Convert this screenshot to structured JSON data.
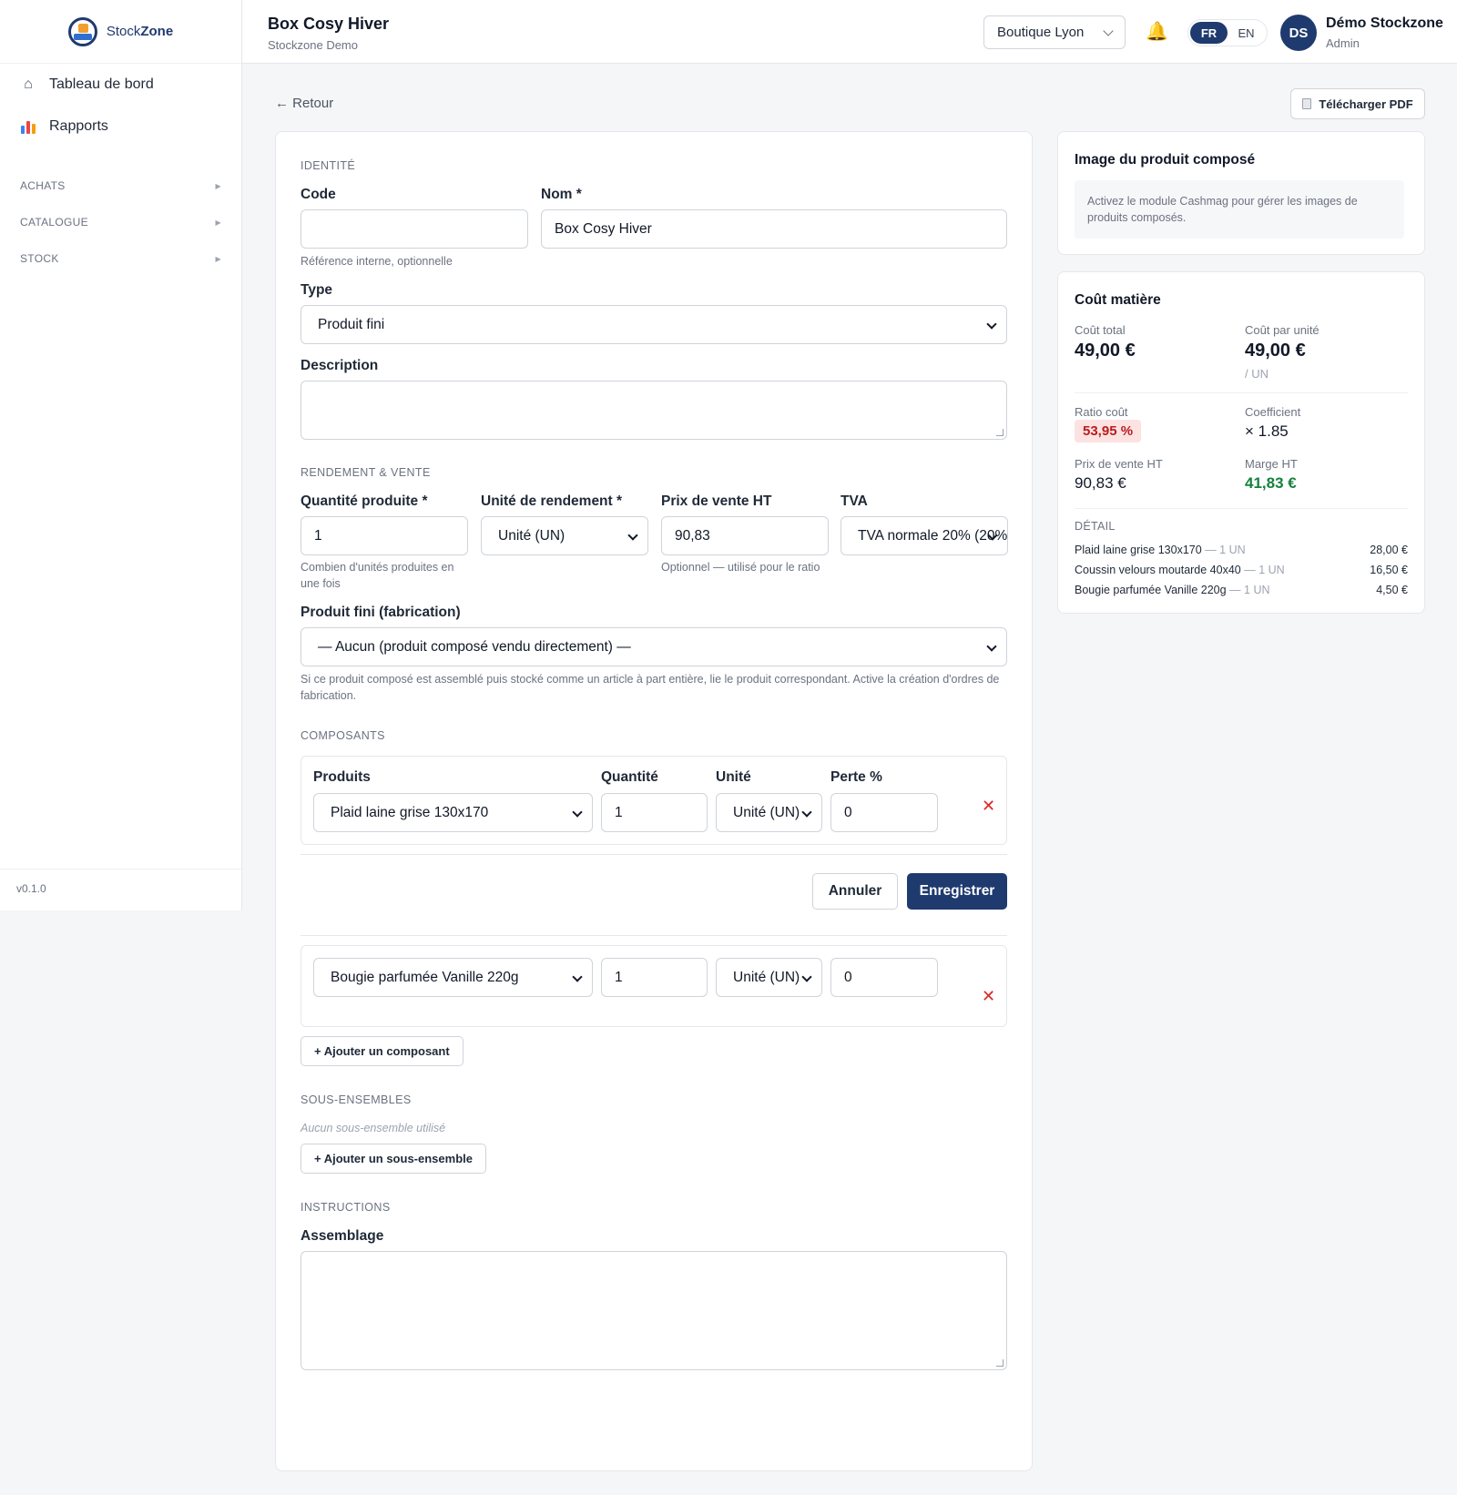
{
  "app": {
    "brand_a": "Stock",
    "brand_b": "Zone",
    "version": "v0.1.0"
  },
  "sidebar": {
    "items": [
      {
        "label": "Tableau de bord",
        "icon": "home-icon"
      },
      {
        "label": "Rapports",
        "icon": "bar-chart-icon"
      }
    ],
    "sections": [
      "ACHATS",
      "CATALOGUE",
      "STOCK"
    ]
  },
  "header": {
    "title": "Box Cosy Hiver",
    "subtitle": "Stockzone Demo",
    "store": "Boutique Lyon",
    "lang_fr": "FR",
    "lang_en": "EN",
    "active_lang": "FR",
    "user_initials": "DS",
    "user_name": "Démo Stockzone",
    "user_role": "Admin"
  },
  "toolbar": {
    "back": "← Retour",
    "pdf": "Télécharger PDF"
  },
  "form": {
    "identity": {
      "section": "IDENTITÉ",
      "code_label": "Code",
      "code_value": "",
      "code_hint": "Référence interne, optionnelle",
      "name_label": "Nom *",
      "name_value": "Box Cosy Hiver",
      "type_label": "Type",
      "type_value": "Produit fini",
      "description_label": "Description"
    },
    "yield": {
      "section": "RENDEMENT & VENTE",
      "qty_label": "Quantité produite *",
      "qty_value": "1",
      "qty_hint": "Combien d'unités produites en une fois",
      "unit_label": "Unité de rendement *",
      "unit_value": "Unité (UN)",
      "price_label": "Prix de vente HT",
      "price_value": "90,83",
      "price_hint": "Optionnel — utilisé pour le ratio",
      "tva_label": "TVA",
      "tva_value": "TVA normale 20% (20%)",
      "finished_label": "Produit fini (fabrication)",
      "finished_value": "— Aucun (produit composé vendu directement) —",
      "finished_hint": "Si ce produit composé est assemblé puis stocké comme un article à part entière, lie le produit correspondant. Active la création d'ordres de fabrication."
    },
    "components": {
      "section": "COMPOSANTS",
      "col_product": "Produits",
      "col_qty": "Quantité",
      "col_unit": "Unité",
      "col_loss": "Perte %",
      "rows": [
        {
          "product": "Plaid laine grise 130x170",
          "qty": "1",
          "unit": "Unité (UN)",
          "loss": "0"
        },
        {
          "product": "Bougie parfumée Vanille 220g",
          "qty": "1",
          "unit": "Unité (UN)",
          "loss": "0"
        }
      ],
      "add": "+ Ajouter un composant"
    },
    "subassemblies": {
      "section": "SOUS-ENSEMBLES",
      "empty": "Aucun sous-ensemble utilisé",
      "add": "+ Ajouter un sous-ensemble"
    },
    "instructions": {
      "section": "INSTRUCTIONS",
      "assembly_label": "Assemblage"
    },
    "actions": {
      "cancel": "Annuler",
      "save": "Enregistrer"
    }
  },
  "image_card": {
    "title": "Image du produit composé",
    "info": "Activez le module Cashmag pour gérer les images de produits composés."
  },
  "cost_card": {
    "title": "Coût matière",
    "total_label": "Coût total",
    "total_value": "49,00 €",
    "unit_cost_label": "Coût par unité",
    "unit_cost_value": "49,00 €",
    "unit_cost_unit": "/ UN",
    "ratio_label": "Ratio coût",
    "ratio_value": "53,95 %",
    "coef_label": "Coefficient",
    "coef_value": "× 1.85",
    "sale_label": "Prix de vente HT",
    "sale_value": "90,83 €",
    "margin_label": "Marge HT",
    "margin_value": "41,83 €",
    "detail_label": "DÉTAIL",
    "details": [
      {
        "name": "Plaid laine grise 130x170",
        "qty": "— 1 UN",
        "amount": "28,00 €"
      },
      {
        "name": "Coussin velours moutarde 40x40",
        "qty": "— 1 UN",
        "amount": "16,50 €"
      },
      {
        "name": "Bougie parfumée Vanille 220g",
        "qty": "— 1 UN",
        "amount": "4,50 €"
      }
    ]
  },
  "colors": {
    "primary": "#1f3a6e",
    "danger": "#dc2626",
    "success": "#15803d",
    "bell": "#f5b400"
  }
}
